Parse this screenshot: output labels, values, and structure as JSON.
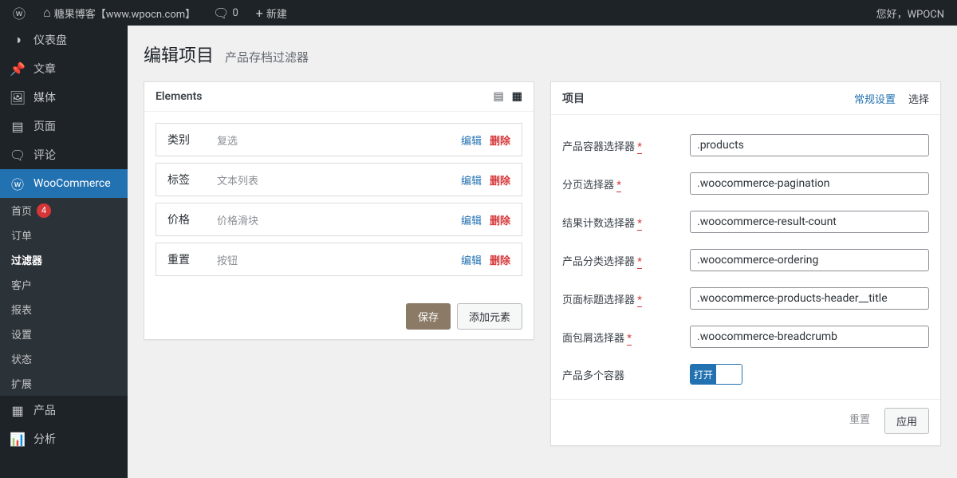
{
  "adminbar": {
    "site_name": "糖果博客【www.wpocn.com】",
    "comments_count": "0",
    "new_label": "新建",
    "greeting": "您好，WPOCN"
  },
  "sidebar": {
    "dashboard": "仪表盘",
    "posts": "文章",
    "media": "媒体",
    "pages": "页面",
    "comments": "评论",
    "woocommerce": "WooCommerce",
    "submenu": {
      "home": "首页",
      "home_badge": "4",
      "orders": "订单",
      "filters": "过滤器",
      "customers": "客户",
      "reports": "报表",
      "settings": "设置",
      "status": "状态",
      "extensions": "扩展"
    },
    "products": "产品",
    "analytics": "分析"
  },
  "page": {
    "title": "编辑项目",
    "subtitle": "产品存档过滤器"
  },
  "elements_panel": {
    "heading": "Elements",
    "save": "保存",
    "add": "添加元素",
    "edit": "编辑",
    "delete": "删除",
    "rows": [
      {
        "name": "类别",
        "type": "复选"
      },
      {
        "name": "标签",
        "type": "文本列表"
      },
      {
        "name": "价格",
        "type": "价格滑块"
      },
      {
        "name": "重置",
        "type": "按钮"
      }
    ]
  },
  "project_panel": {
    "heading": "项目",
    "tab_general": "常规设置",
    "tab_select": "选择",
    "reset": "重置",
    "apply": "应用",
    "toggle_on": "打开",
    "fields": [
      {
        "label": "产品容器选择器",
        "required": true,
        "value": ".products"
      },
      {
        "label": "分页选择器",
        "required": true,
        "value": ".woocommerce-pagination"
      },
      {
        "label": "结果计数选择器",
        "required": true,
        "value": ".woocommerce-result-count"
      },
      {
        "label": "产品分类选择器",
        "required": true,
        "value": ".woocommerce-ordering"
      },
      {
        "label": "页面标题选择器",
        "required": true,
        "value": ".woocommerce-products-header__title"
      },
      {
        "label": "面包屑选择器",
        "required": true,
        "value": ".woocommerce-breadcrumb"
      },
      {
        "label": "产品多个容器",
        "required": false,
        "value": "",
        "toggle": true
      }
    ]
  }
}
